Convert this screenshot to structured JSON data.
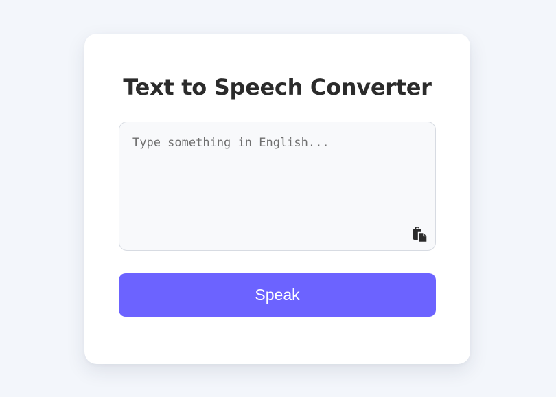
{
  "title": "Text to Speech Converter",
  "input": {
    "placeholder": "Type something in English...",
    "value": ""
  },
  "copy_button": {
    "icon": "copy-icon"
  },
  "speak_button": {
    "label": "Speak"
  },
  "colors": {
    "background": "#f3f6fb",
    "card": "#ffffff",
    "title": "#2b2b2b",
    "accent": "#6c63ff",
    "input_bg": "#f8f9fb",
    "input_border": "#d7dbe2"
  }
}
